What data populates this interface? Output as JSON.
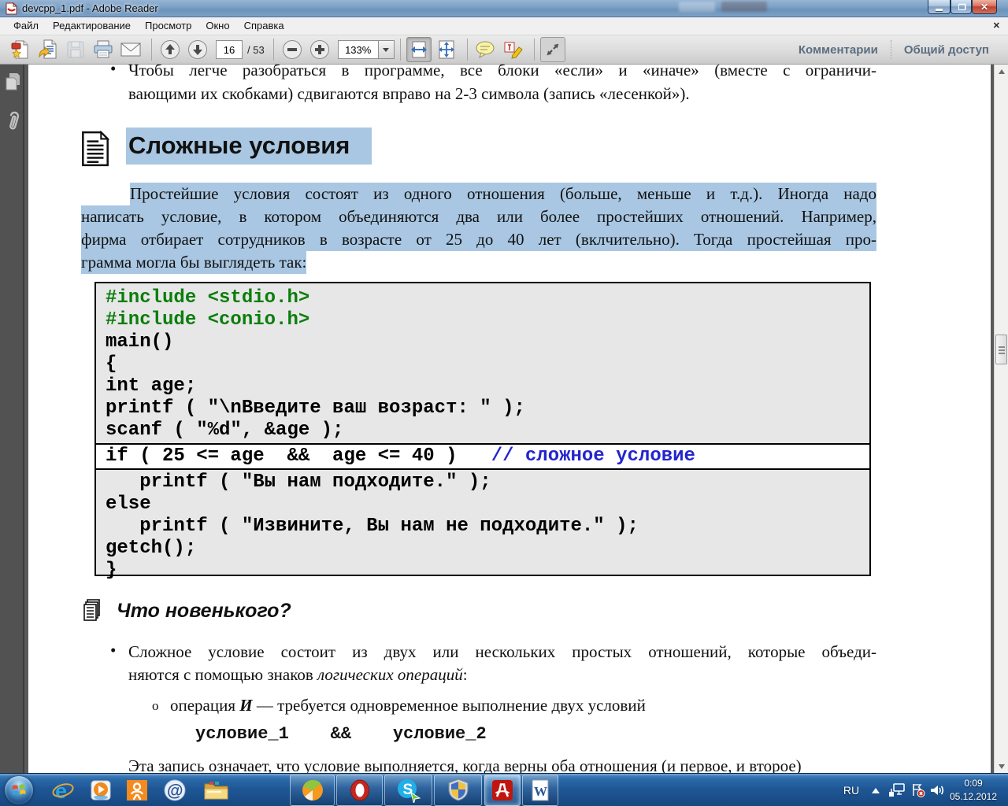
{
  "window": {
    "title": "devcpp_1.pdf - Adobe Reader"
  },
  "menu": {
    "items": [
      "Файл",
      "Редактирование",
      "Просмотр",
      "Окно",
      "Справка"
    ],
    "close_label": "✕"
  },
  "toolbar": {
    "page_current": "16",
    "page_total": "/ 53",
    "zoom_level": "133%",
    "comments_label": "Комментарии",
    "share_label": "Общий доступ"
  },
  "document": {
    "bullet1": {
      "dot": "•",
      "line1": "Чтобы легче разобраться в программе, все блоки «если» и «иначе» (вместе с ограничи-",
      "line2": "вающими их скобками) сдвигаются вправо на 2-3 символа (запись «лесенкой»)."
    },
    "section": {
      "title": "Сложные условия"
    },
    "intro": {
      "line1": "Простейшие условия состоят из одного отношения (больше, меньше и т.д.). Иногда надо",
      "line2": "написать условие, в котором объединяются два или более простейших отношений. Например,",
      "line3": "фирма отбирает сотрудников в возрасте от 25 до 40 лет (вклчительно). Тогда простейшая про-",
      "line4": "грамма могла бы выглядеть так:"
    },
    "whats_new": {
      "title": "Что новенького?"
    },
    "bullet2": {
      "dot": "•",
      "line1": "Сложное условие состоит из двух или нескольких простых отношений, которые объеди-",
      "line2_pre": "няются с помощью знаков ",
      "line2_italic": "логических операций",
      "line2_post": ":"
    },
    "sub_bullet": {
      "marker": "o",
      "pre": "операция ",
      "op": "И",
      "post": " — требуется одновременное выполнение двух условий"
    },
    "condition_line": "условие_1    &&    условие_2",
    "partial_line": "Эта запись означает, что условие выполняется, когда верны оба отношения (и первое, и второе)"
  },
  "code": {
    "lines": [
      {
        "text": "#include <stdio.h>",
        "style": "include"
      },
      {
        "text": "#include <conio.h>",
        "style": "include"
      },
      {
        "text": "main()",
        "style": "plain"
      },
      {
        "text": "{",
        "style": "plain"
      },
      {
        "text": "int age;",
        "style": "plain"
      },
      {
        "text": "printf ( \"\\nВведите ваш возраст: \" );",
        "style": "plain"
      },
      {
        "text": "scanf ( \"%d\", &age );",
        "style": "plain"
      },
      {
        "code": "if ( 25 <= age  &&  age <= 40 )   ",
        "comment": "// сложное условие",
        "style": "highlight"
      },
      {
        "text": "   printf ( \"Вы нам подходите.\" );",
        "style": "plain"
      },
      {
        "text": "else",
        "style": "plain"
      },
      {
        "text": "   printf ( \"Извините, Вы нам не подходите.\" );",
        "style": "plain"
      },
      {
        "text": "getch();",
        "style": "plain"
      },
      {
        "text": "}",
        "style": "plain"
      }
    ]
  },
  "taskbar": {
    "apps": [
      {
        "id": "internet-explorer",
        "boxed": false,
        "active": false
      },
      {
        "id": "media-player",
        "boxed": false,
        "active": false
      },
      {
        "id": "odnoklassniki",
        "boxed": false,
        "active": false
      },
      {
        "id": "mail-ru",
        "boxed": false,
        "active": false
      },
      {
        "id": "explorer-folder",
        "boxed": false,
        "active": false
      },
      {
        "id": "aimp",
        "boxed": true,
        "active": false
      },
      {
        "id": "opera",
        "boxed": true,
        "active": false
      },
      {
        "id": "skype",
        "boxed": true,
        "active": false
      },
      {
        "id": "windows-defender",
        "boxed": true,
        "active": false
      },
      {
        "id": "adobe-reader",
        "boxed": true,
        "active": true
      },
      {
        "id": "word",
        "boxed": true,
        "active": false
      }
    ],
    "tray": {
      "language": "RU",
      "time": "0:09",
      "date": "05.12.2012"
    }
  },
  "colors": {
    "selection": "#a9c7e2",
    "code_green": "#0b7d0b",
    "comment_blue": "#2424cf",
    "code_bg": "#e7e7e7"
  }
}
